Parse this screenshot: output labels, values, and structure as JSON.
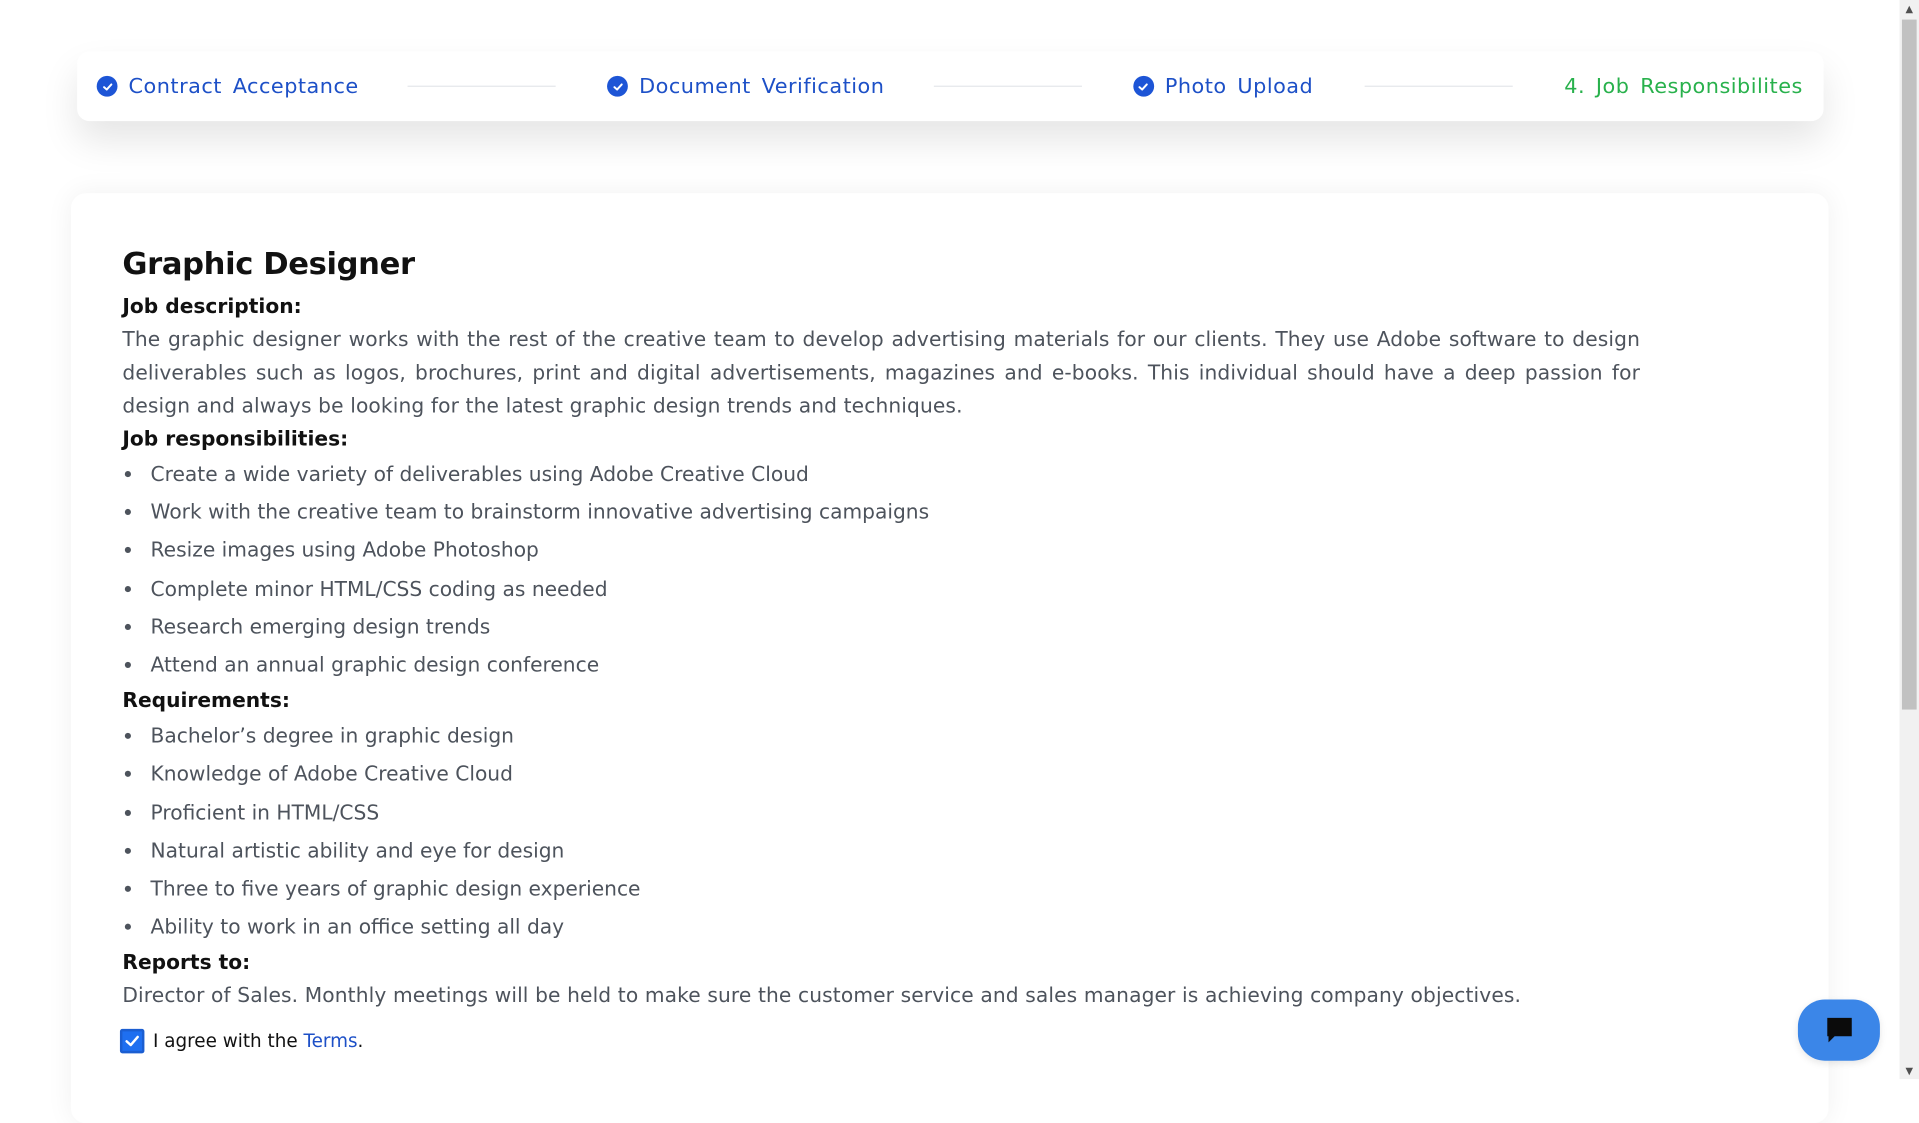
{
  "stepper": {
    "steps": [
      {
        "label": "Contract Acceptance",
        "state": "completed"
      },
      {
        "label": "Document Verification",
        "state": "completed"
      },
      {
        "label": "Photo Upload",
        "state": "completed"
      },
      {
        "label": "4. Job Responsibilites",
        "state": "active"
      }
    ]
  },
  "job": {
    "title": "Graphic Designer",
    "description_label": "Job description:",
    "description": "The graphic designer works with the rest of the creative team to develop advertising materials for our clients. They use Adobe software to design deliverables such as logos, brochures, print and digital advertisements, magazines and e-books. This individual should have a deep passion for design and always be looking for the latest graphic design trends and techniques.",
    "responsibilities_label": "Job responsibilities:",
    "responsibilities": [
      "Create a wide variety of deliverables using Adobe Creative Cloud",
      "Work with the creative team to brainstorm innovative advertising campaigns",
      "Resize images using Adobe Photoshop",
      "Complete minor HTML/CSS coding as needed",
      "Research emerging design trends",
      "Attend an annual graphic design conference"
    ],
    "requirements_label": "Requirements:",
    "requirements": [
      "Bachelor’s degree in graphic design",
      "Knowledge of Adobe Creative Cloud",
      "Proficient in HTML/CSS",
      "Natural artistic ability and eye for design",
      "Three to five years of graphic design experience",
      "Ability to work in an office setting all day"
    ],
    "reports_label": "Reports to:",
    "reports": "Director of Sales. Monthly meetings will be held to make sure the customer service and sales manager is achieving company objectives."
  },
  "agreement": {
    "prefix": "I agree with the ",
    "link": "Terms",
    "suffix": ".",
    "checked": true
  },
  "colors": {
    "accent": "#1d50c7",
    "active_step": "#28b14c",
    "chat_button": "#3b86e8"
  },
  "icons": {
    "step_check": "check-circle-icon",
    "chat": "chat-bubble-icon"
  }
}
